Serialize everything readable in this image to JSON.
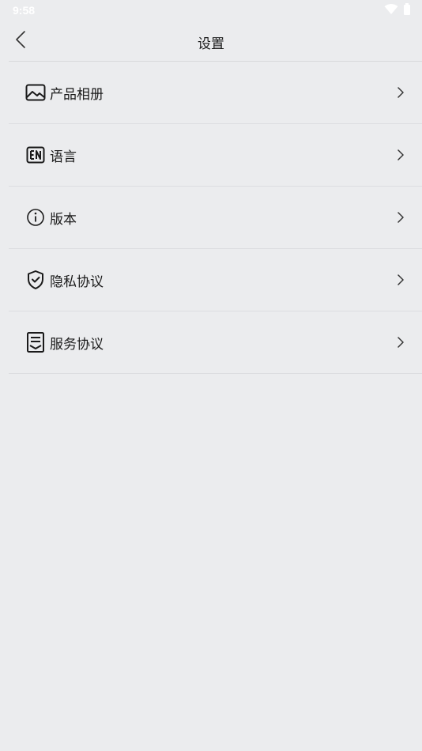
{
  "status_bar": {
    "time": "9:58",
    "icons": [
      "wifi-icon",
      "battery-icon"
    ]
  },
  "header": {
    "title": "设置",
    "back_icon": "chevron-left-icon"
  },
  "settings": {
    "items": [
      {
        "label": "产品相册",
        "icon": "image-icon"
      },
      {
        "label": "语言",
        "icon": "en-language-icon"
      },
      {
        "label": "版本",
        "icon": "info-icon"
      },
      {
        "label": "隐私协议",
        "icon": "shield-check-icon"
      },
      {
        "label": "服务协议",
        "icon": "document-icon"
      }
    ]
  },
  "colors": {
    "background": "#ebecee",
    "text": "#1a1a1a",
    "divider": "#dcdde0"
  }
}
